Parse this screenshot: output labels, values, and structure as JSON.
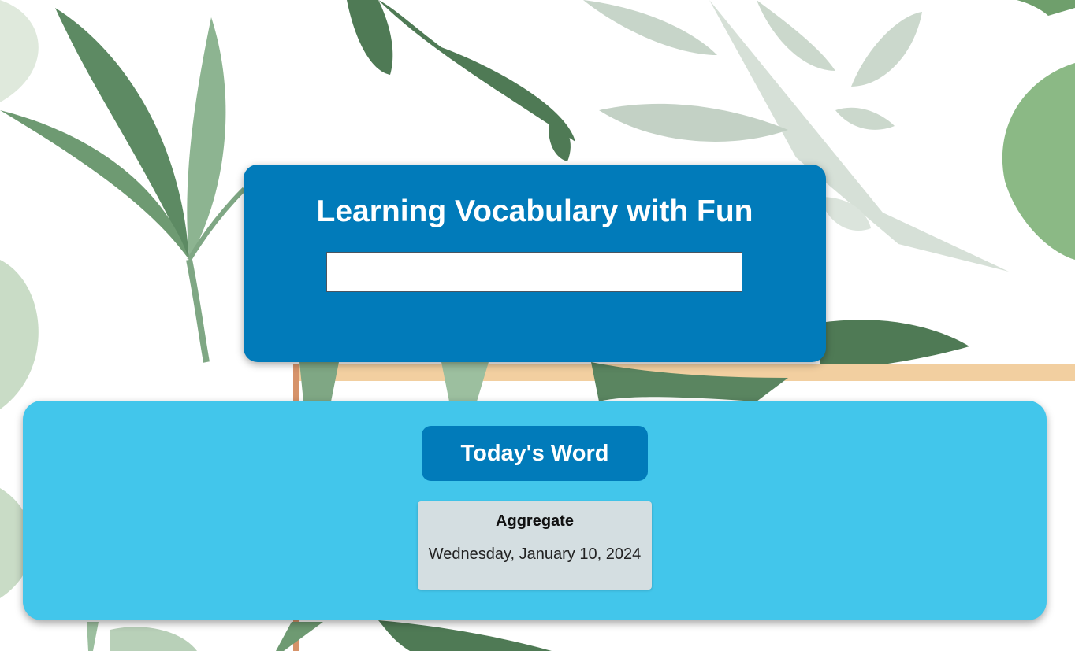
{
  "app": {
    "title": "Learning Vocabulary with Fun"
  },
  "search": {
    "value": "",
    "placeholder": ""
  },
  "word_section": {
    "button_label": "Today's Word",
    "word": "Aggregate",
    "date": "Wednesday, January 10, 2024"
  },
  "colors": {
    "header_blue": "#017bba",
    "panel_cyan": "#42c6eb",
    "card_gray": "#d4dee1"
  }
}
